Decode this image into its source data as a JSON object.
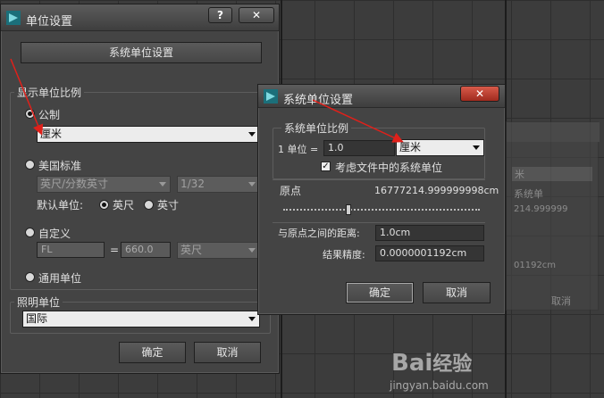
{
  "unit_setup": {
    "title": "单位设置",
    "help_btn": "?",
    "close_btn": "✕",
    "system_unit_setup_btn": "系统单位设置",
    "display_scale_label": "显示单位比例",
    "metric_label": "公制",
    "metric_value": "厘米",
    "us_standard_label": "美国标准",
    "us_standard_value": "英尺/分数英寸",
    "fraction_value": "1/32",
    "default_unit_label": "默认单位:",
    "default_feet": "英尺",
    "default_inches": "英寸",
    "custom_label": "自定义",
    "custom_name": "FL",
    "custom_equals": "=",
    "custom_value": "660.0",
    "custom_unit": "英尺",
    "generic_label": "通用单位",
    "lighting_label": "照明单位",
    "lighting_value": "国际",
    "ok": "确定",
    "cancel": "取消"
  },
  "system_unit_setup": {
    "title": "系统单位设置",
    "close_btn": "✕",
    "scale_group": "系统单位比例",
    "one_unit_label": "1 单位 =",
    "scale_value": "1.0",
    "scale_unit": "厘米",
    "consider_files_label": "考虑文件中的系统单位",
    "origin_label": "原点",
    "origin_value": "16777214.999999998cm",
    "distance_label": "与原点之间的距离:",
    "distance_value": "1.0cm",
    "precision_label": "结果精度:",
    "precision_value": "0.0000001192cm",
    "ok": "确定",
    "cancel": "取消"
  },
  "background_dialog": {
    "partial_texts": [
      "米",
      "系统单",
      "214.999999",
      "01192cm",
      "取消"
    ]
  },
  "watermark": {
    "brand": "Bai",
    "brand2": "经验",
    "url": "jingyan.baidu.com"
  }
}
